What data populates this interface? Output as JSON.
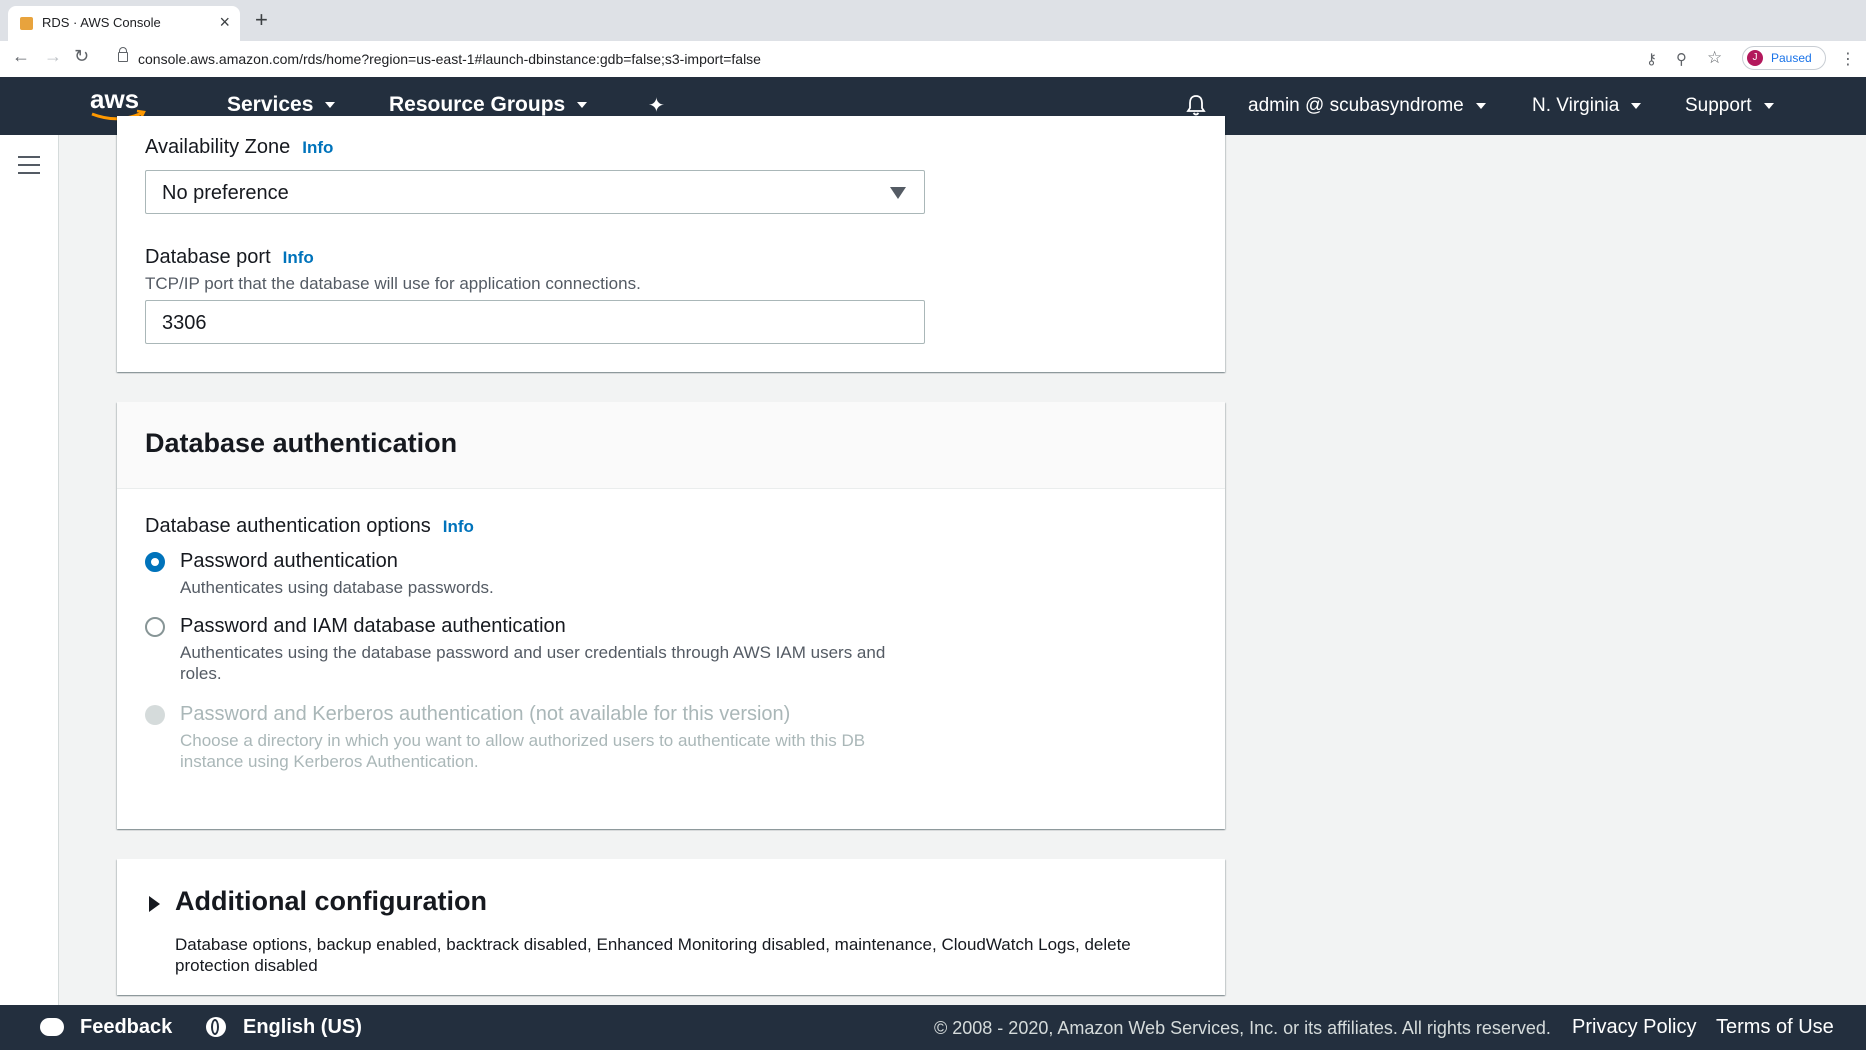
{
  "browser": {
    "tab_title": "RDS · AWS Console",
    "url": "console.aws.amazon.com/rds/home?region=us-east-1#launch-dbinstance:gdb=false;s3-import=false",
    "profile_initial": "J",
    "profile_status": "Paused"
  },
  "nav": {
    "services": "Services",
    "resource_groups": "Resource Groups",
    "account": "admin @ scubasyndrome",
    "region": "N. Virginia",
    "support": "Support"
  },
  "connectivity": {
    "availability_zone_label": "Availability Zone",
    "info": "Info",
    "availability_zone_value": "No preference",
    "port_label": "Database port",
    "port_description": "TCP/IP port that the database will use for application connections.",
    "port_value": "3306"
  },
  "auth": {
    "title": "Database authentication",
    "options_label": "Database authentication options",
    "info": "Info",
    "options": [
      {
        "title": "Password authentication",
        "description": "Authenticates using database passwords.",
        "selected": true,
        "disabled": false
      },
      {
        "title": "Password and IAM database authentication",
        "description_line1": "Authenticates using the database password and user credentials through AWS IAM users and",
        "description_line2": "roles.",
        "selected": false,
        "disabled": false
      },
      {
        "title": "Password and Kerberos authentication (not available for this version)",
        "description_line1": "Choose a directory in which you want to allow authorized users to authenticate with this DB",
        "description_line2": "instance using Kerberos Authentication.",
        "selected": false,
        "disabled": true
      }
    ]
  },
  "additional": {
    "title": "Additional configuration",
    "description_line1": "Database options, backup enabled, backtrack disabled, Enhanced Monitoring disabled, maintenance, CloudWatch Logs, delete",
    "description_line2": "protection disabled"
  },
  "footer": {
    "feedback": "Feedback",
    "language": "English (US)",
    "copyright": "© 2008 - 2020, Amazon Web Services, Inc. or its affiliates. All rights reserved.",
    "privacy": "Privacy Policy",
    "terms": "Terms of Use"
  },
  "colors": {
    "nav_bg": "#232f3e",
    "link": "#0073bb",
    "page_bg": "#f2f3f3"
  }
}
